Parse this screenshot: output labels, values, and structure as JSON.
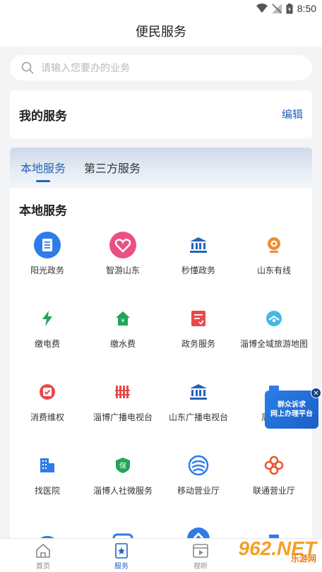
{
  "status_bar": {
    "time": "8:50"
  },
  "header": {
    "title": "便民服务"
  },
  "search": {
    "placeholder": "请输入您要办的业务"
  },
  "my_services": {
    "title": "我的服务",
    "edit_label": "编辑"
  },
  "tabs": [
    {
      "label": "本地服务",
      "active": true
    },
    {
      "label": "第三方服务",
      "active": false
    }
  ],
  "local_services": {
    "title": "本地服务",
    "items": [
      {
        "label": "阳光政务",
        "icon": "document-icon",
        "color": "#2f7ce8"
      },
      {
        "label": "智游山东",
        "icon": "heart-icon",
        "color": "#ec4f86"
      },
      {
        "label": "秒懂政务",
        "icon": "government-building-icon",
        "color": "#2563b8"
      },
      {
        "label": "山东有线",
        "icon": "webcam-icon",
        "color": "#f08c2e"
      },
      {
        "label": "缴电费",
        "icon": "lightning-icon",
        "color": "#22a559"
      },
      {
        "label": "缴水费",
        "icon": "house-yen-icon",
        "color": "#22a559"
      },
      {
        "label": "政务服务",
        "icon": "checklist-icon",
        "color": "#e84a4a"
      },
      {
        "label": "淄博全域旅游地图",
        "icon": "travel-globe-icon",
        "color": "#43b8e8"
      },
      {
        "label": "消费维权",
        "icon": "shield-check-icon",
        "color": "#e84a4a"
      },
      {
        "label": "淄博广播电视台",
        "icon": "bars-icon",
        "color": "#e84a4a"
      },
      {
        "label": "山东广播电视台",
        "icon": "government-building-icon",
        "color": "#2563b8"
      },
      {
        "label": "周村品",
        "icon": "shop-icon",
        "color": "#2f7ce8"
      },
      {
        "label": "找医院",
        "icon": "hospital-icon",
        "color": "#2f7ce8"
      },
      {
        "label": "淄博人社微服务",
        "icon": "badge-icon",
        "color": "#22a559"
      },
      {
        "label": "移动营业厅",
        "icon": "china-mobile-icon",
        "color": "#2f7ce8"
      },
      {
        "label": "联通营业厅",
        "icon": "china-unicom-icon",
        "color": "#e8542e"
      }
    ]
  },
  "float_ad": {
    "line1": "群众诉求",
    "line2": "网上办理平台"
  },
  "bottom_nav": [
    {
      "label": "首页",
      "icon": "home-icon",
      "active": false
    },
    {
      "label": "服务",
      "icon": "star-bookmark-icon",
      "active": true
    },
    {
      "label": "视听",
      "icon": "play-video-icon",
      "active": false
    }
  ],
  "watermark": {
    "main": "962.NET",
    "sub": "乐游网"
  }
}
